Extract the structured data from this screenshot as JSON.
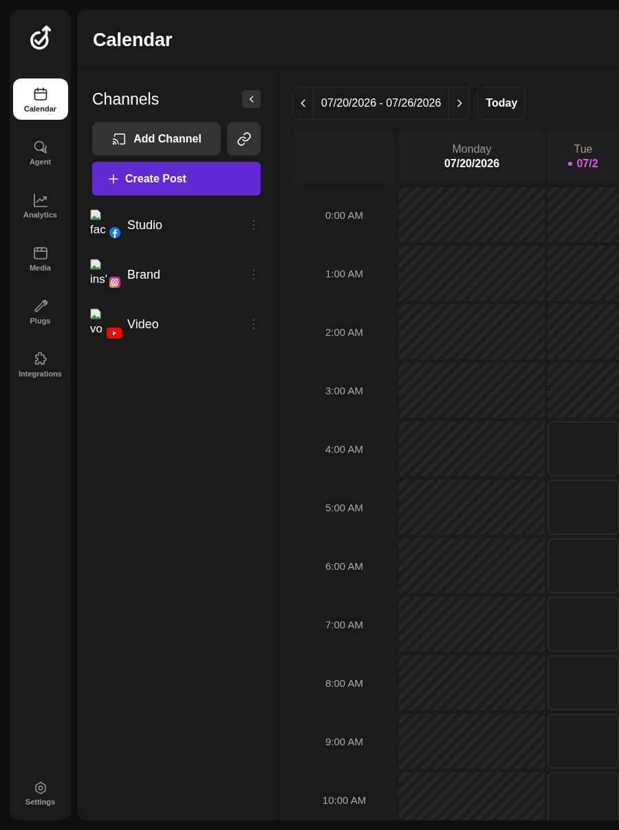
{
  "nav": [
    {
      "kind": "calendar",
      "label": "Calendar",
      "selected": true
    },
    {
      "kind": "chat",
      "label": "Agent",
      "selected": false
    },
    {
      "kind": "chart",
      "label": "Analytics",
      "selected": false
    },
    {
      "kind": "media",
      "label": "Media",
      "selected": false
    },
    {
      "kind": "wrench",
      "label": "Plugs",
      "selected": false
    },
    {
      "kind": "puzzle",
      "label": "Integrations",
      "selected": false
    }
  ],
  "settings": {
    "label": "Settings"
  },
  "page_title": "Calendar",
  "channels": {
    "title": "Channels",
    "add_button": "Add Channel",
    "create_button": "Create Post",
    "items": [
      {
        "avatar_alt": "fac",
        "kind": "facebook",
        "name": "Studio"
      },
      {
        "avatar_alt": "ins'",
        "kind": "instagram",
        "name": "Brand"
      },
      {
        "avatar_alt": "vo",
        "kind": "youtube",
        "name": "Video"
      }
    ]
  },
  "week": {
    "range": "07/20/2026 - 07/26/2026",
    "today_button": "Today"
  },
  "days": [
    {
      "name": "Monday",
      "date": "07/20/2026",
      "today": false
    },
    {
      "name": "Tue",
      "date": "07/2",
      "today": true
    }
  ],
  "rows": [
    {
      "time": "0:00 AM",
      "cells": [
        {
          "past": true
        },
        {
          "past": true
        }
      ]
    },
    {
      "time": "1:00 AM",
      "cells": [
        {
          "past": true
        },
        {
          "past": true
        }
      ]
    },
    {
      "time": "2:00 AM",
      "cells": [
        {
          "past": true
        },
        {
          "past": true
        }
      ]
    },
    {
      "time": "3:00 AM",
      "cells": [
        {
          "past": true
        },
        {
          "past": true
        }
      ]
    },
    {
      "time": "4:00 AM",
      "cells": [
        {
          "past": true
        },
        {
          "past": false
        }
      ]
    },
    {
      "time": "5:00 AM",
      "cells": [
        {
          "past": true
        },
        {
          "past": false
        }
      ]
    },
    {
      "time": "6:00 AM",
      "cells": [
        {
          "past": true
        },
        {
          "past": false
        }
      ]
    },
    {
      "time": "7:00 AM",
      "cells": [
        {
          "past": true
        },
        {
          "past": false
        }
      ]
    },
    {
      "time": "8:00 AM",
      "cells": [
        {
          "past": true
        },
        {
          "past": false
        }
      ]
    },
    {
      "time": "9:00 AM",
      "cells": [
        {
          "past": true
        },
        {
          "past": false
        }
      ]
    },
    {
      "time": "10:00 AM",
      "cells": [
        {
          "past": true
        },
        {
          "past": false
        }
      ]
    }
  ]
}
